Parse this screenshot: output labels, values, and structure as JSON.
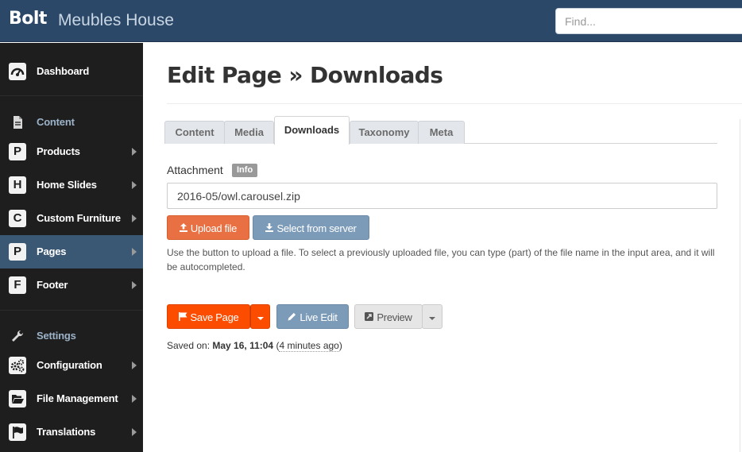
{
  "topbar": {
    "brand": "Bolt",
    "site_name": "Meubles House",
    "search_placeholder": "Find..."
  },
  "sidebar": {
    "items": [
      {
        "label": "Dashboard",
        "badge": "",
        "icon": "dashboard-icon"
      },
      {
        "label": "Content",
        "badge": "",
        "icon": "document-icon",
        "section": true
      },
      {
        "label": "Products",
        "badge": "P"
      },
      {
        "label": "Home Slides",
        "badge": "H"
      },
      {
        "label": "Custom Furniture",
        "badge": "C"
      },
      {
        "label": "Pages",
        "badge": "P",
        "active": true
      },
      {
        "label": "Footer",
        "badge": "F"
      },
      {
        "label": "Settings",
        "badge": "",
        "icon": "wrench-icon",
        "section": true
      },
      {
        "label": "Configuration",
        "badge": "",
        "icon": "gears-icon"
      },
      {
        "label": "File Management",
        "badge": "",
        "icon": "folder-open-icon"
      },
      {
        "label": "Translations",
        "badge": "",
        "icon": "flag-icon"
      }
    ]
  },
  "main": {
    "title_bold": "Edit Page",
    "title_rest": " » Downloads",
    "tabs": [
      "Content",
      "Media",
      "Downloads",
      "Taxonomy",
      "Meta"
    ],
    "active_tab": "Downloads",
    "attachment_label": "Attachment",
    "info_badge": "Info",
    "attachment_value": "2016-05/owl.carousel.zip",
    "upload_label": "Upload file",
    "select_label": "Select from server",
    "help_text": "Use the button to upload a file. To select a previously uploaded file, you can type (part) of the file name in the input area, and it will be autocompleted.",
    "save_label": "Save Page",
    "live_edit_label": "Live Edit",
    "preview_label": "Preview",
    "saved_prefix": "Saved on: ",
    "saved_date": "May 16, 11:04",
    "saved_ago": "4 minutes ago"
  },
  "colors": {
    "topbar": "#2b4868",
    "sidebar": "#1e1e1e",
    "sidebar_active": "#3a5874",
    "save_button": "#fb4c00",
    "upload_button": "#e87042",
    "secondary_button": "#7c9bb8"
  }
}
